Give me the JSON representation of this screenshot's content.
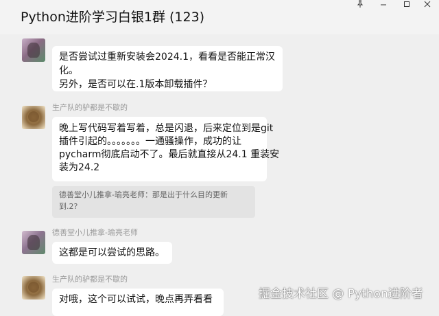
{
  "window": {
    "title": "Python进阶学习白银1群 (123)",
    "controls": [
      "pin",
      "minimize",
      "maximize",
      "close"
    ]
  },
  "messages": [
    {
      "sender": "",
      "lines": [
        "是否尝试过重新安装会2024.1，看看是否能正常汉",
        "化。",
        "另外，是否可以在.1版本卸载插件？"
      ]
    },
    {
      "sender": "生产队的驴都是不歇的",
      "lines": [
        "晚上写代码写着写着，总是闪退，后来定位到是git",
        "插件引起的。。。。。。。一通骚操作，成功的让",
        "pycharm彻底启动不了。最后就直接从24.1 重装安",
        "装为24.2"
      ],
      "quote": [
        "德善堂小儿推拿-瑜亮老师：那是出于什么目的更新",
        "到.2?"
      ]
    },
    {
      "sender": "德善堂小儿推拿-瑜亮老师",
      "lines": [
        "这都是可以尝试的思路。"
      ]
    },
    {
      "sender": "生产队的驴都是不歇的",
      "lines": [
        "对哦，这个可以试试，晚点再弄看看"
      ]
    }
  ],
  "watermark": "掘金技术社区 @ Python进阶者"
}
